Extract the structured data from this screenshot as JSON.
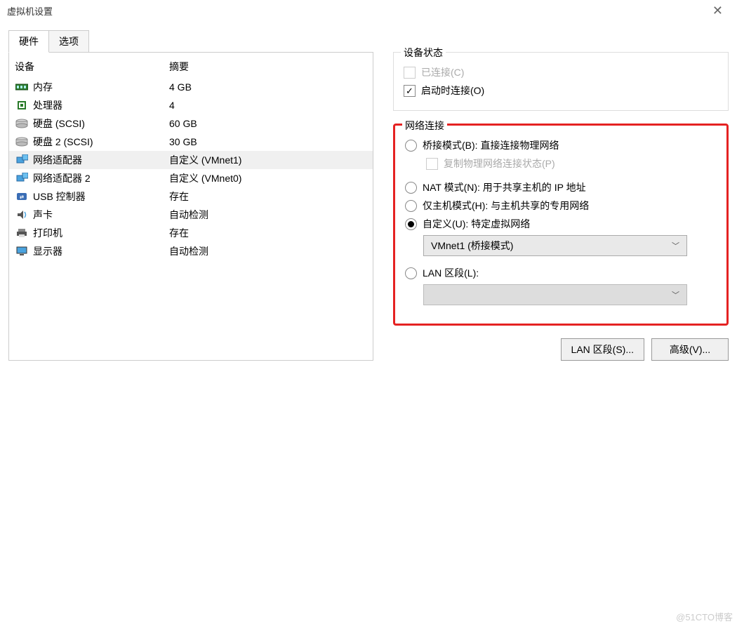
{
  "window": {
    "title": "虚拟机设置"
  },
  "tabs": {
    "hardware": "硬件",
    "options": "选项"
  },
  "deviceTable": {
    "header": {
      "device": "设备",
      "summary": "摘要"
    },
    "rows": [
      {
        "name": "内存",
        "summary": "4 GB",
        "icon": "memory"
      },
      {
        "name": "处理器",
        "summary": "4",
        "icon": "cpu"
      },
      {
        "name": "硬盘 (SCSI)",
        "summary": "60 GB",
        "icon": "disk"
      },
      {
        "name": "硬盘 2 (SCSI)",
        "summary": "30 GB",
        "icon": "disk"
      },
      {
        "name": "网络适配器",
        "summary": "自定义 (VMnet1)",
        "icon": "nic",
        "selected": true
      },
      {
        "name": "网络适配器 2",
        "summary": "自定义 (VMnet0)",
        "icon": "nic"
      },
      {
        "name": "USB 控制器",
        "summary": "存在",
        "icon": "usb"
      },
      {
        "name": "声卡",
        "summary": "自动检测",
        "icon": "sound"
      },
      {
        "name": "打印机",
        "summary": "存在",
        "icon": "printer"
      },
      {
        "name": "显示器",
        "summary": "自动检测",
        "icon": "display"
      }
    ]
  },
  "deviceStatus": {
    "legend": "设备状态",
    "connected": "已连接(C)",
    "connectAtPowerOn": "启动时连接(O)"
  },
  "networkConnection": {
    "legend": "网络连接",
    "bridged": "桥接模式(B): 直接连接物理网络",
    "replicate": "复制物理网络连接状态(P)",
    "nat": "NAT 模式(N): 用于共享主机的 IP 地址",
    "hostOnly": "仅主机模式(H): 与主机共享的专用网络",
    "custom": "自定义(U): 特定虚拟网络",
    "customSelect": "VMnet1 (桥接模式)",
    "lanSegment": "LAN 区段(L):"
  },
  "buttons": {
    "lanSegments": "LAN 区段(S)...",
    "advanced": "高级(V)..."
  },
  "watermark": "@51CTO博客"
}
